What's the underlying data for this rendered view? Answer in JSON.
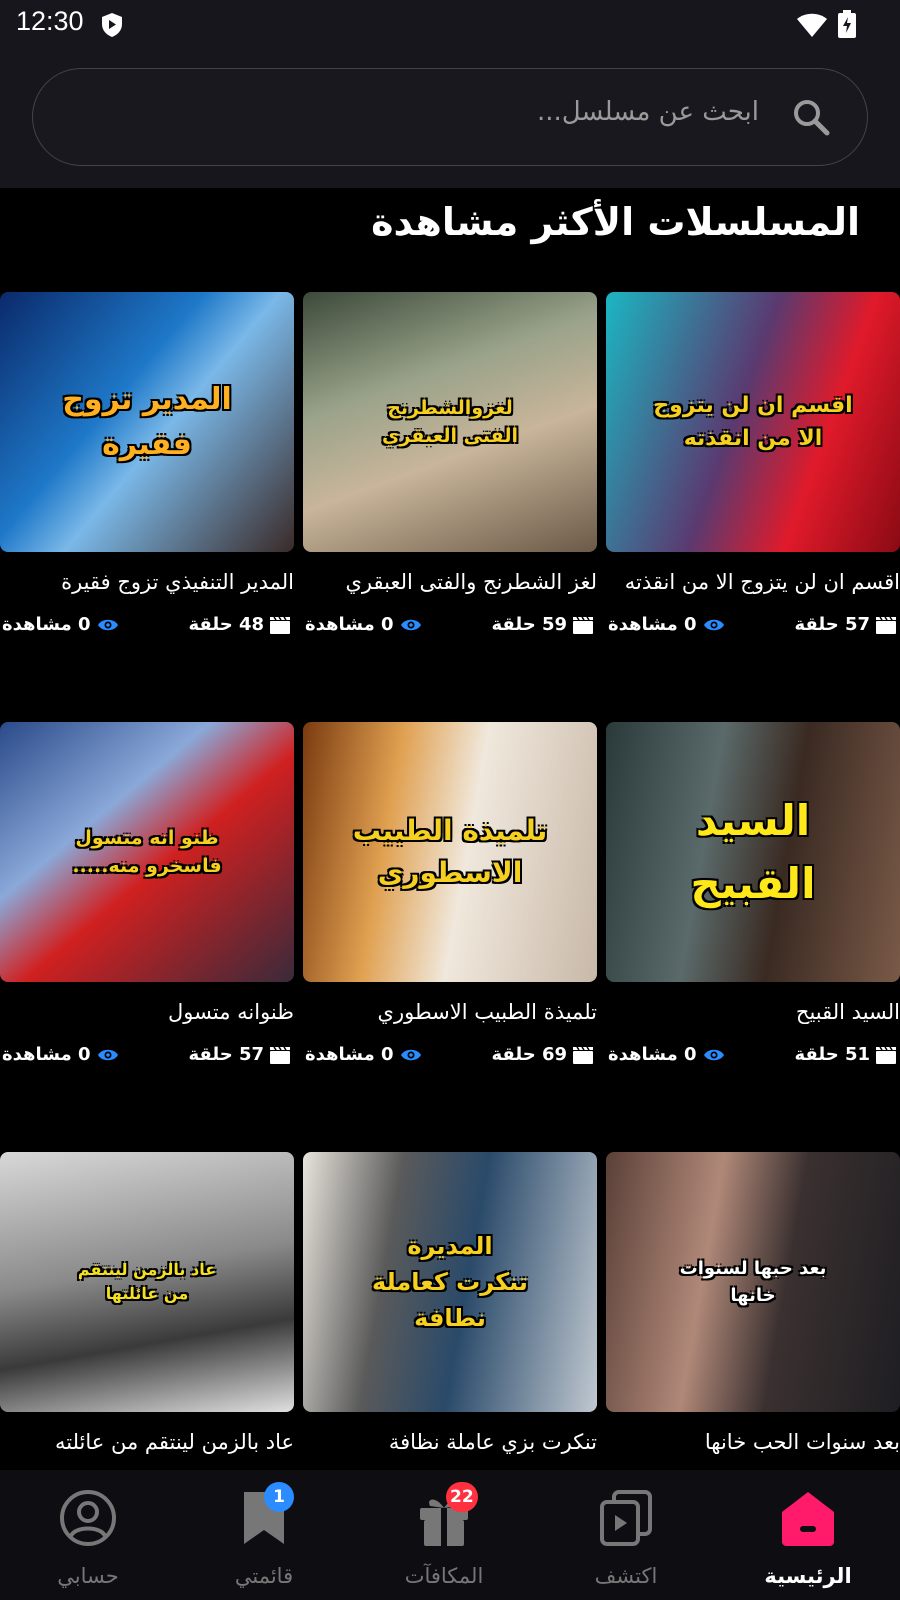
{
  "status_bar": {
    "time": "12:30"
  },
  "search": {
    "placeholder": "ابحث عن مسلسل..."
  },
  "section": {
    "title": "المسلسلات الأكثر مشاهدة"
  },
  "cards": [
    {
      "title": "اقسم ان لن يتزوج الا من انقذته",
      "overlay": "اقسم ان لن يتزوج\nالا من انقذته",
      "episodes": "57 حلقة",
      "views": "0 مشاهدة",
      "bg": "linear-gradient(110deg,#1bb6c2 0%,#5a3a70 45%,#e01a2a 70%,#8a0a14 100%)",
      "overlay_color": "#f5d020",
      "overlay_size": "22px"
    },
    {
      "title": "لغز الشطرنج والفتى العبقري",
      "overlay": "لغزوالشطرنج\nالفتى العبقري",
      "episodes": "59 حلقة",
      "views": "0 مشاهدة",
      "bg": "linear-gradient(160deg,#3c4a3a 0%,#9aa38a 35%,#c8b59a 60%,#6b5a48 100%)",
      "overlay_color": "#f5d020",
      "overlay_size": "19px"
    },
    {
      "title": "المدير التنفيذي تزوج فقيرة",
      "overlay": "المدير تزوج\nفقيرة",
      "episodes": "48 حلقة",
      "views": "0 مشاهدة",
      "bg": "linear-gradient(130deg,#0a2a6a 0%,#1e78c8 40%,#7ab8e8 55%,#3a2a28 100%)",
      "overlay_color": "#ffb020",
      "overlay_size": "30px"
    },
    {
      "title": "السيد القبيح",
      "overlay": "السيد\nالقبيح",
      "episodes": "51 حلقة",
      "views": "0 مشاهدة",
      "bg": "linear-gradient(100deg,#2a3a3a 0%,#5a6a6a 35%,#3a2a22 60%,#7a5a48 100%)",
      "overlay_color": "#ffe81a",
      "overlay_size": "42px"
    },
    {
      "title": "تلميذة الطبيب الاسطوري",
      "overlay": "تلميذة الطبيب\nالاسطوري",
      "episodes": "69 حلقة",
      "views": "0 مشاهدة",
      "bg": "linear-gradient(100deg,#7a3a10 0%,#e0a050 30%,#f0e8dc 55%,#c8b8a8 100%)",
      "overlay_color": "#f5d020",
      "overlay_size": "28px"
    },
    {
      "title": "ظنوانه متسول",
      "overlay": "ظنو انه متسول\nفاسخرو منه.....",
      "episodes": "57 حلقة",
      "views": "0 مشاهدة",
      "bg": "linear-gradient(140deg,#2a4a8a 0%,#8aa8d8 35%,#d02020 55%,#3a2a3a 100%)",
      "overlay_color": "#f5d020",
      "overlay_size": "19px"
    },
    {
      "title": "بعد سنوات الحب خانها",
      "overlay": "بعد حبها لسنوات\nخانها",
      "episodes": "",
      "views": "",
      "bg": "linear-gradient(100deg,#5a4038 0%,#b08878 35%,#3a3030 60%,#1e1e22 100%)",
      "overlay_color": "#ffffff",
      "overlay_size": "18px"
    },
    {
      "title": "تنكرت بزي عاملة نظافة",
      "overlay": "المديرة\nتنكرت كعاملة\nنطافة",
      "episodes": "",
      "views": "",
      "bg": "linear-gradient(100deg,#e8e4dc 0%,#5a5a5a 30%,#2a4a6a 55%,#c0c8d0 100%)",
      "overlay_color": "#f5d020",
      "overlay_size": "24px"
    },
    {
      "title": "عاد بالزمن لينتقم من عائلته",
      "overlay": "عاد بالزمن لينتقم\nمن عائلتها",
      "episodes": "",
      "views": "",
      "bg": "linear-gradient(170deg,#d8d8d8 0%,#8a8a8a 45%,#3a3a3a 70%,#e0e0e0 100%)",
      "overlay_color": "#f5e020",
      "overlay_size": "16px"
    }
  ],
  "nav": {
    "home": "الرئيسية",
    "discover": "اكتشف",
    "rewards": "المكافآت",
    "rewards_badge": "22",
    "mylist": "قائمتي",
    "mylist_badge": "1",
    "account": "حسابي"
  },
  "colors": {
    "accent": "#ff1a6a",
    "eye_icon": "#2a8cff",
    "badge_blue": "#2a8cff",
    "badge_red": "#ff3040"
  }
}
